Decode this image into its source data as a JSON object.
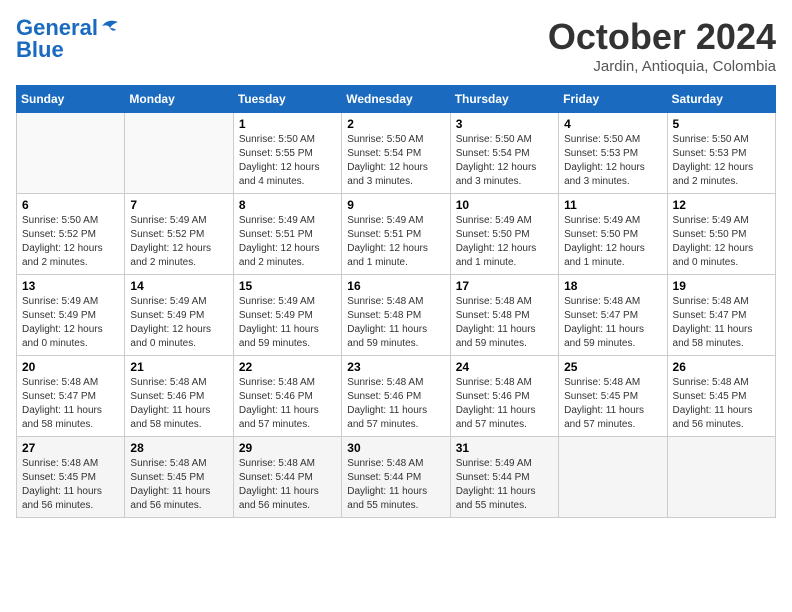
{
  "header": {
    "logo_line1": "General",
    "logo_line2": "Blue",
    "month": "October 2024",
    "location": "Jardin, Antioquia, Colombia"
  },
  "weekdays": [
    "Sunday",
    "Monday",
    "Tuesday",
    "Wednesday",
    "Thursday",
    "Friday",
    "Saturday"
  ],
  "weeks": [
    [
      {
        "day": "",
        "info": ""
      },
      {
        "day": "",
        "info": ""
      },
      {
        "day": "1",
        "info": "Sunrise: 5:50 AM\nSunset: 5:55 PM\nDaylight: 12 hours\nand 4 minutes."
      },
      {
        "day": "2",
        "info": "Sunrise: 5:50 AM\nSunset: 5:54 PM\nDaylight: 12 hours\nand 3 minutes."
      },
      {
        "day": "3",
        "info": "Sunrise: 5:50 AM\nSunset: 5:54 PM\nDaylight: 12 hours\nand 3 minutes."
      },
      {
        "day": "4",
        "info": "Sunrise: 5:50 AM\nSunset: 5:53 PM\nDaylight: 12 hours\nand 3 minutes."
      },
      {
        "day": "5",
        "info": "Sunrise: 5:50 AM\nSunset: 5:53 PM\nDaylight: 12 hours\nand 2 minutes."
      }
    ],
    [
      {
        "day": "6",
        "info": "Sunrise: 5:50 AM\nSunset: 5:52 PM\nDaylight: 12 hours\nand 2 minutes."
      },
      {
        "day": "7",
        "info": "Sunrise: 5:49 AM\nSunset: 5:52 PM\nDaylight: 12 hours\nand 2 minutes."
      },
      {
        "day": "8",
        "info": "Sunrise: 5:49 AM\nSunset: 5:51 PM\nDaylight: 12 hours\nand 2 minutes."
      },
      {
        "day": "9",
        "info": "Sunrise: 5:49 AM\nSunset: 5:51 PM\nDaylight: 12 hours\nand 1 minute."
      },
      {
        "day": "10",
        "info": "Sunrise: 5:49 AM\nSunset: 5:50 PM\nDaylight: 12 hours\nand 1 minute."
      },
      {
        "day": "11",
        "info": "Sunrise: 5:49 AM\nSunset: 5:50 PM\nDaylight: 12 hours\nand 1 minute."
      },
      {
        "day": "12",
        "info": "Sunrise: 5:49 AM\nSunset: 5:50 PM\nDaylight: 12 hours\nand 0 minutes."
      }
    ],
    [
      {
        "day": "13",
        "info": "Sunrise: 5:49 AM\nSunset: 5:49 PM\nDaylight: 12 hours\nand 0 minutes."
      },
      {
        "day": "14",
        "info": "Sunrise: 5:49 AM\nSunset: 5:49 PM\nDaylight: 12 hours\nand 0 minutes."
      },
      {
        "day": "15",
        "info": "Sunrise: 5:49 AM\nSunset: 5:49 PM\nDaylight: 11 hours\nand 59 minutes."
      },
      {
        "day": "16",
        "info": "Sunrise: 5:48 AM\nSunset: 5:48 PM\nDaylight: 11 hours\nand 59 minutes."
      },
      {
        "day": "17",
        "info": "Sunrise: 5:48 AM\nSunset: 5:48 PM\nDaylight: 11 hours\nand 59 minutes."
      },
      {
        "day": "18",
        "info": "Sunrise: 5:48 AM\nSunset: 5:47 PM\nDaylight: 11 hours\nand 59 minutes."
      },
      {
        "day": "19",
        "info": "Sunrise: 5:48 AM\nSunset: 5:47 PM\nDaylight: 11 hours\nand 58 minutes."
      }
    ],
    [
      {
        "day": "20",
        "info": "Sunrise: 5:48 AM\nSunset: 5:47 PM\nDaylight: 11 hours\nand 58 minutes."
      },
      {
        "day": "21",
        "info": "Sunrise: 5:48 AM\nSunset: 5:46 PM\nDaylight: 11 hours\nand 58 minutes."
      },
      {
        "day": "22",
        "info": "Sunrise: 5:48 AM\nSunset: 5:46 PM\nDaylight: 11 hours\nand 57 minutes."
      },
      {
        "day": "23",
        "info": "Sunrise: 5:48 AM\nSunset: 5:46 PM\nDaylight: 11 hours\nand 57 minutes."
      },
      {
        "day": "24",
        "info": "Sunrise: 5:48 AM\nSunset: 5:46 PM\nDaylight: 11 hours\nand 57 minutes."
      },
      {
        "day": "25",
        "info": "Sunrise: 5:48 AM\nSunset: 5:45 PM\nDaylight: 11 hours\nand 57 minutes."
      },
      {
        "day": "26",
        "info": "Sunrise: 5:48 AM\nSunset: 5:45 PM\nDaylight: 11 hours\nand 56 minutes."
      }
    ],
    [
      {
        "day": "27",
        "info": "Sunrise: 5:48 AM\nSunset: 5:45 PM\nDaylight: 11 hours\nand 56 minutes."
      },
      {
        "day": "28",
        "info": "Sunrise: 5:48 AM\nSunset: 5:45 PM\nDaylight: 11 hours\nand 56 minutes."
      },
      {
        "day": "29",
        "info": "Sunrise: 5:48 AM\nSunset: 5:44 PM\nDaylight: 11 hours\nand 56 minutes."
      },
      {
        "day": "30",
        "info": "Sunrise: 5:48 AM\nSunset: 5:44 PM\nDaylight: 11 hours\nand 55 minutes."
      },
      {
        "day": "31",
        "info": "Sunrise: 5:49 AM\nSunset: 5:44 PM\nDaylight: 11 hours\nand 55 minutes."
      },
      {
        "day": "",
        "info": ""
      },
      {
        "day": "",
        "info": ""
      }
    ]
  ]
}
